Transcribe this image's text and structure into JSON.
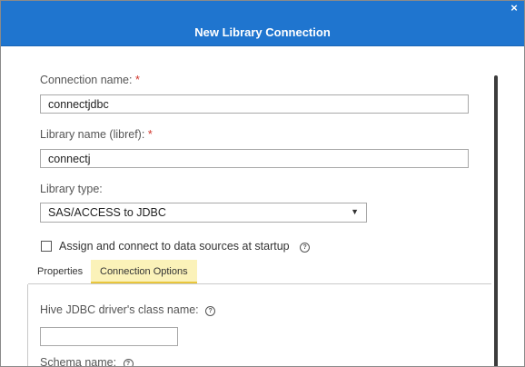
{
  "dialog": {
    "title": "New Library Connection",
    "close_icon": "×"
  },
  "form": {
    "connection_name": {
      "label": "Connection name:",
      "required": "*",
      "value": "connectjdbc"
    },
    "library_name": {
      "label": "Library name (libref):",
      "required": "*",
      "value": "connectj"
    },
    "library_type": {
      "label": "Library type:",
      "selected": "SAS/ACCESS to JDBC",
      "arrow": "▼"
    },
    "startup": {
      "label": "Assign and connect to data sources at startup",
      "checked": false,
      "help": "?"
    }
  },
  "tabs": [
    {
      "label": "Properties",
      "active": false
    },
    {
      "label": "Connection Options",
      "active": true
    }
  ],
  "connection_options": {
    "driver_class": {
      "label": "Hive JDBC driver's class name:",
      "help": "?",
      "value": ""
    },
    "schema": {
      "label": "Schema name:",
      "help": "?"
    }
  },
  "colors": {
    "titlebar": "#1f75cf",
    "required": "#d1352b",
    "active_tab": "#fbf2b9"
  }
}
